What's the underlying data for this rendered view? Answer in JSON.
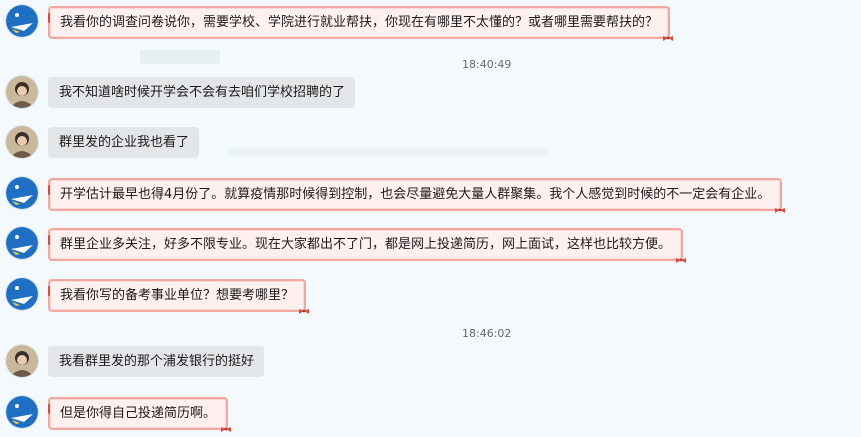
{
  "messages": [
    {
      "side": "right",
      "avatar": "blue-avatar",
      "text": "我看你的调查问卷说你，需要学校、学院进行就业帮扶，你现在有哪里不太懂的？或者哪里需要帮扶的？"
    },
    {
      "side": "left",
      "avatar": "photo-avatar",
      "text": "我不知道啥时候开学会不会有去咱们学校招聘的了"
    },
    {
      "side": "left",
      "avatar": "photo-avatar",
      "text": "群里发的企业我也看了"
    },
    {
      "side": "right",
      "avatar": "blue-avatar",
      "text": "开学估计最早也得4月份了。就算疫情那时候得到控制，也会尽量避免大量人群聚集。我个人感觉到时候的不一定会有企业。"
    },
    {
      "side": "right",
      "avatar": "blue-avatar",
      "text": "群里企业多关注，好多不限专业。现在大家都出不了门，都是网上投递简历，网上面试，这样也比较方便。"
    },
    {
      "side": "right",
      "avatar": "blue-avatar",
      "text": "我看你写的备考事业单位？想要考哪里？"
    },
    {
      "side": "left",
      "avatar": "photo-avatar",
      "text": "我看群里发的那个浦发银行的挺好"
    },
    {
      "side": "right",
      "avatar": "blue-avatar",
      "text": "但是你得自己投递简历啊。"
    }
  ],
  "timestamps": [
    "18:40:49",
    "18:46:02"
  ],
  "colors": {
    "background": "#f3f9fc",
    "left_bubble": "#e3e6e8",
    "right_bubble": "#fff1ef",
    "right_border": "#f2a7a0"
  }
}
